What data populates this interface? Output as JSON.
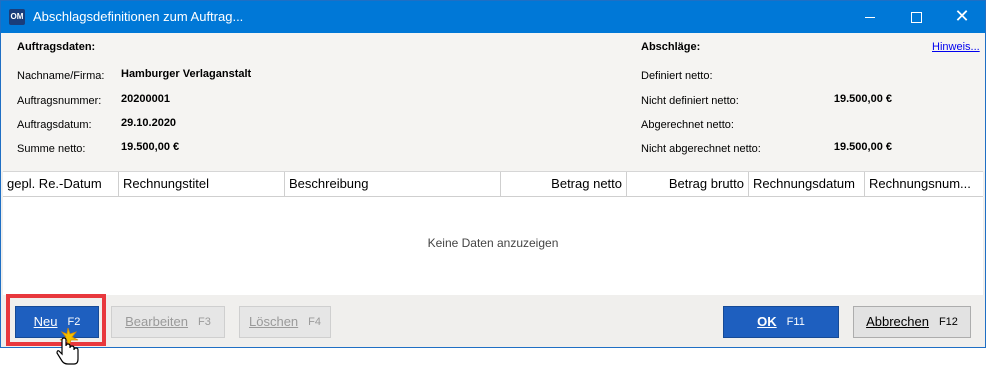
{
  "window": {
    "app_icon_text": "OM",
    "title": "Abschlagsdefinitionen zum Auftrag...",
    "close_glyph": "✕"
  },
  "auftragsdaten": {
    "header": "Auftragsdaten:",
    "fields": [
      {
        "label": "Nachname/Firma:",
        "value": "Hamburger Verlaganstalt"
      },
      {
        "label": "Auftragsnummer:",
        "value": "20200001"
      },
      {
        "label": "Auftragsdatum:",
        "value": "29.10.2020"
      },
      {
        "label": "Summe netto:",
        "value": "19.500,00 €"
      }
    ]
  },
  "abschlaege": {
    "header": "Abschläge:",
    "hint_link": "Hinweis...",
    "fields": [
      {
        "label": "Definiert netto:",
        "value": ""
      },
      {
        "label": "Nicht definiert netto:",
        "value": "19.500,00 €"
      },
      {
        "label": "Abgerechnet netto:",
        "value": ""
      },
      {
        "label": "Nicht abgerechnet netto:",
        "value": "19.500,00 €"
      }
    ]
  },
  "table": {
    "columns": [
      "gepl. Re.-Datum",
      "Rechnungstitel",
      "Beschreibung",
      "Betrag netto",
      "Betrag brutto",
      "Rechnungsdatum",
      "Rechnungsnum..."
    ],
    "empty_text": "Keine Daten anzuzeigen"
  },
  "buttons": {
    "neu": {
      "label": "Neu",
      "key": "F2"
    },
    "bearbeiten": {
      "label": "Bearbeiten",
      "key": "F3"
    },
    "loeschen": {
      "label": "Löschen",
      "key": "F4"
    },
    "ok": {
      "label": "OK",
      "key": "F11"
    },
    "abbrechen": {
      "label": "Abbrechen",
      "key": "F12"
    }
  },
  "colors": {
    "titlebar": "#0078d7",
    "primary_button": "#1e5fbf",
    "highlight": "#e8383d"
  },
  "icons": {
    "app": "app-logo-icon",
    "minimize": "minimize-icon",
    "maximize": "maximize-icon",
    "close": "close-icon",
    "cursor": "hand-cursor-icon"
  }
}
